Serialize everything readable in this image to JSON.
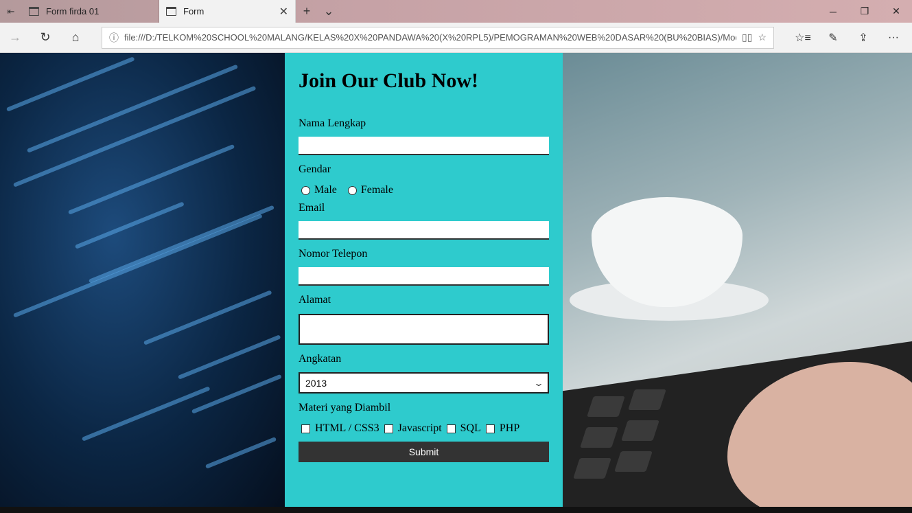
{
  "browser": {
    "tabs": [
      {
        "title": "Form firda 01",
        "active": false
      },
      {
        "title": "Form",
        "active": true
      }
    ],
    "url": "file:///D:/TELKOM%20SCHOOL%20MALANG/KELAS%20X%20PANDAWA%20(X%20RPL5)/PEMOGRAMAN%20WEB%20DASAR%20(BU%20BIAS)/Modul%"
  },
  "form": {
    "title": "Join Our Club Now!",
    "name_label": "Nama Lengkap",
    "name_value": "",
    "gender_label": "Gendar",
    "gender_options": [
      "Male",
      "Female"
    ],
    "email_label": "Email",
    "email_value": "",
    "phone_label": "Nomor Telepon",
    "phone_value": "",
    "address_label": "Alamat",
    "address_value": "",
    "year_label": "Angkatan",
    "year_selected": "2013",
    "subjects_label": "Materi yang Diambil",
    "subjects": [
      "HTML / CSS3",
      "Javascript",
      "SQL",
      "PHP"
    ],
    "submit_label": "Submit"
  },
  "colors": {
    "panel": "#2ecbcd",
    "submit_bg": "#333333"
  }
}
